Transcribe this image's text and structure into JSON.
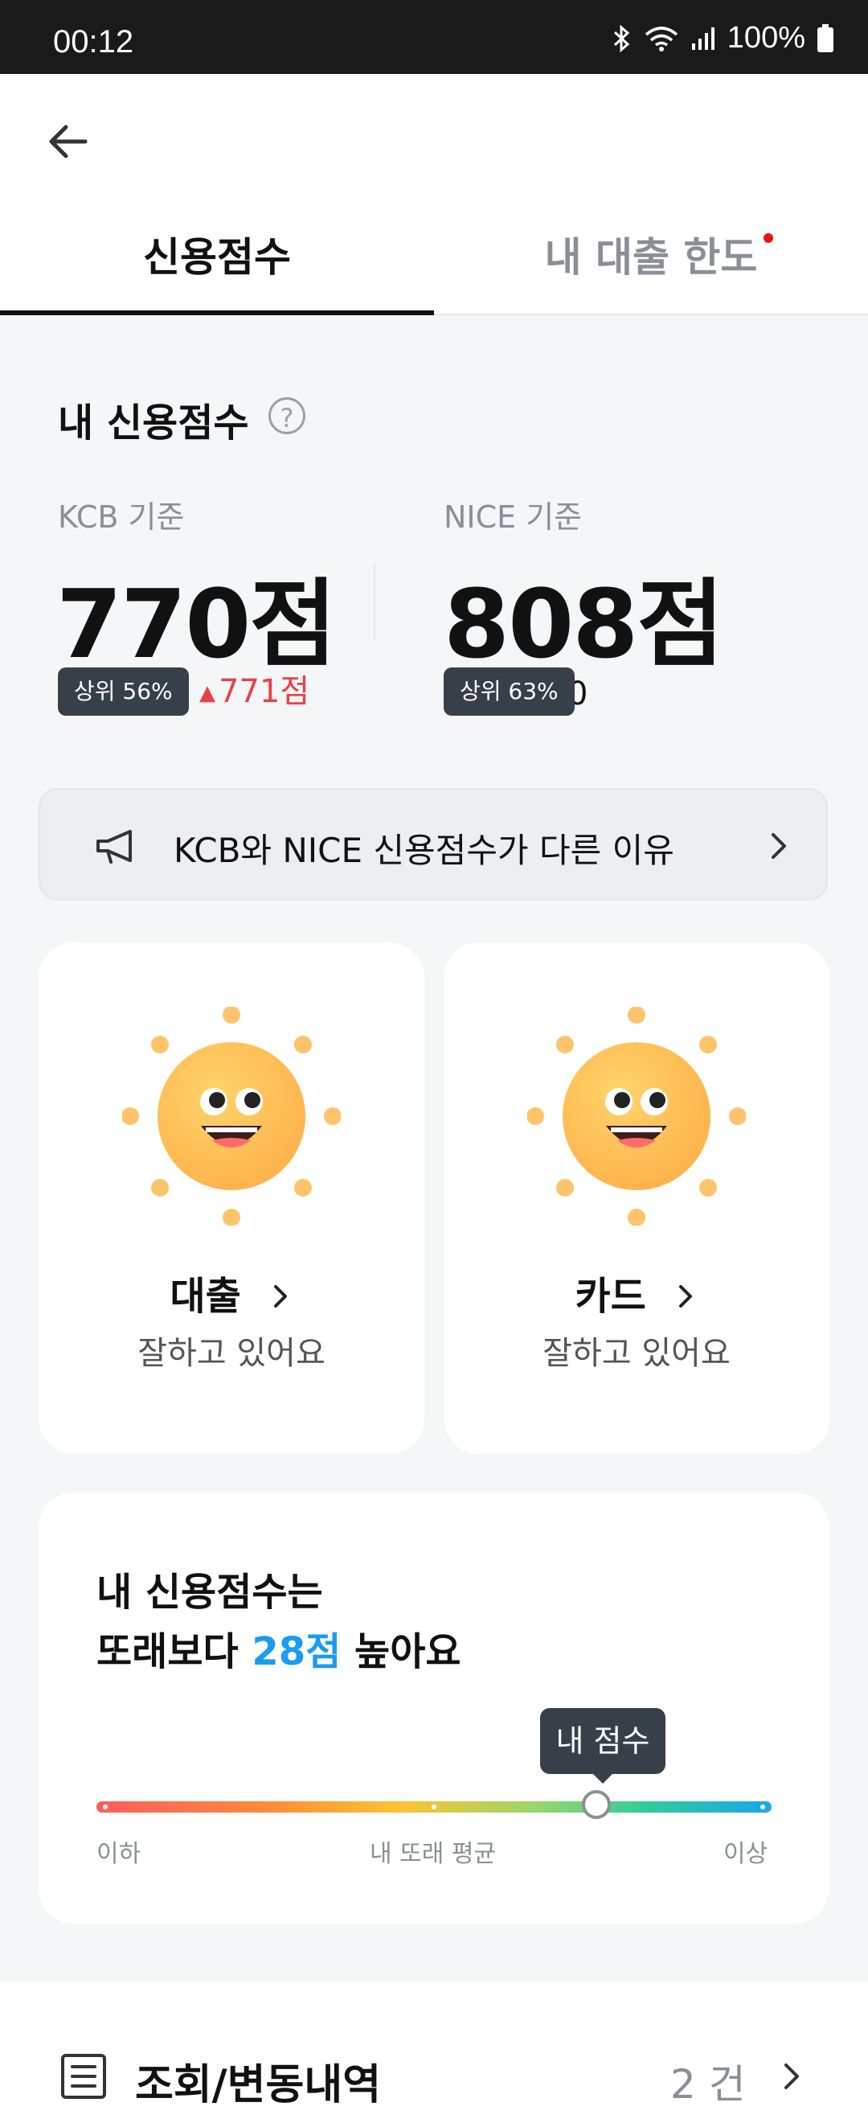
{
  "status_bar": {
    "time": "00:12",
    "battery": "100%",
    "icons": [
      "bluetooth-icon",
      "wifi-icon",
      "signal-icon",
      "battery-icon"
    ]
  },
  "nav": {
    "back_icon": "arrow-left-icon"
  },
  "tabs": [
    {
      "label": "신용점수",
      "active": true
    },
    {
      "label": "내 대출 한도",
      "active": false,
      "has_dot": true
    }
  ],
  "score": {
    "title": "내 신용점수",
    "help_icon": "question-circle-icon",
    "kcb": {
      "label": "KCB 기준",
      "value": "770점",
      "rank": "상위 56%",
      "change": "771점"
    },
    "nice": {
      "label": "NICE 기준",
      "value": "808점",
      "rank": "상위 63%",
      "extra": "0"
    }
  },
  "notice": {
    "text": "KCB와 NICE 신용점수가 다른 이유",
    "icon": "megaphone-icon"
  },
  "cards": [
    {
      "title": "대출",
      "subtitle": "잘하고 있어요",
      "icon": "sun-face-icon"
    },
    {
      "title": "카드",
      "subtitle": "잘하고 있어요",
      "icon": "sun-face-icon"
    }
  ],
  "peer": {
    "line1": "내 신용점수는",
    "line2_prefix": "또래보다 ",
    "line2_highlight": "28점",
    "line2_suffix": " 높아요",
    "marker_label": "내 점수",
    "marker_position": 0.74,
    "axis": {
      "low": "이하",
      "mid": "내 또래 평균",
      "high": "이상"
    },
    "highlight_color": "#1a9cf0"
  },
  "history": {
    "title": "조회/변동내역",
    "count": "2 건",
    "icon": "list-icon"
  },
  "colors": {
    "accent": "#1a9cf0",
    "delta_up": "#e84149",
    "pill": "#374048"
  }
}
